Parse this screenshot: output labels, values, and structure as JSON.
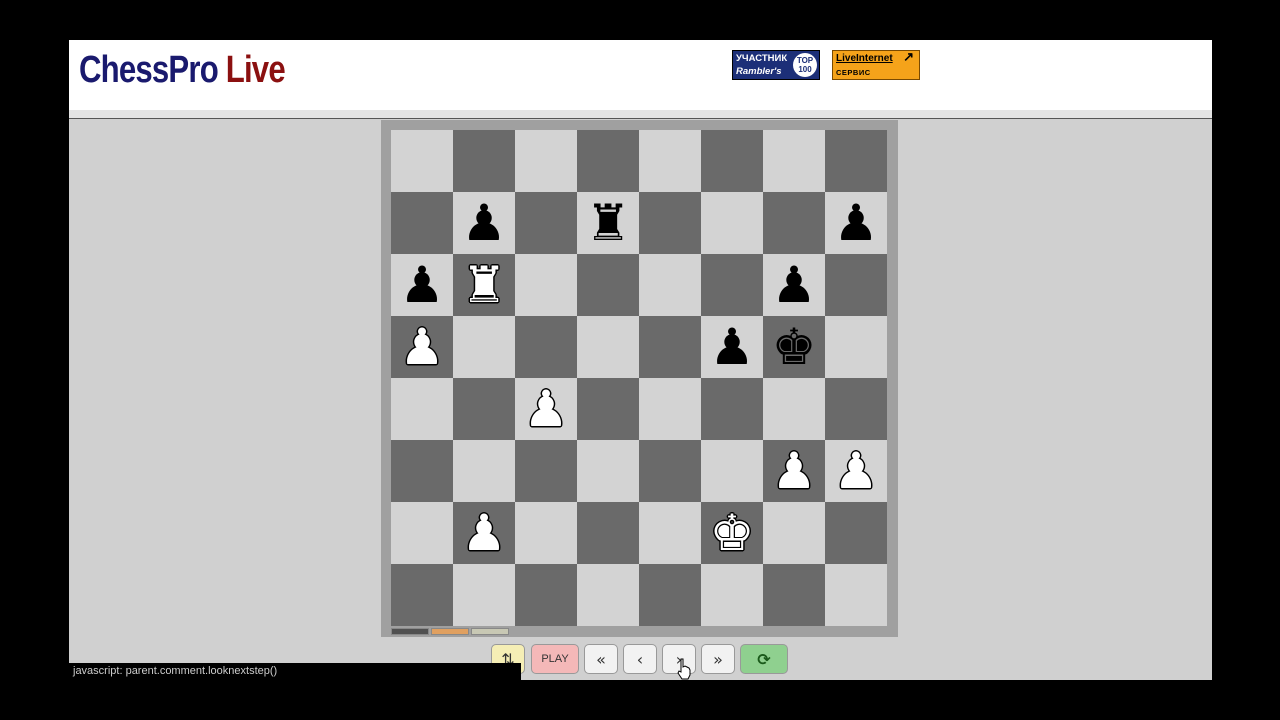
{
  "header": {
    "logo_main": "ChessPro",
    "logo_accent": "Live",
    "rambler_counter": {
      "line1": "УЧАСТНИК",
      "line2": "Rambler's",
      "badge_top": "TOP",
      "badge_num": "100"
    },
    "liveinternet_counter": {
      "line1": "LiveInternet",
      "line2": "СЕРВИС СТАТИСТИКИ"
    }
  },
  "board": {
    "light_color": "#d3d3d3",
    "dark_color": "#6a6a6a",
    "pieces": [
      {
        "square": "d7",
        "color": "black",
        "type": "rook",
        "glyph": "♜"
      },
      {
        "square": "b7",
        "color": "black",
        "type": "pawn",
        "glyph": "♟"
      },
      {
        "square": "h7",
        "color": "black",
        "type": "pawn",
        "glyph": "♟"
      },
      {
        "square": "a6",
        "color": "black",
        "type": "pawn",
        "glyph": "♟"
      },
      {
        "square": "g6",
        "color": "black",
        "type": "pawn",
        "glyph": "♟"
      },
      {
        "square": "f5",
        "color": "black",
        "type": "pawn",
        "glyph": "♟"
      },
      {
        "square": "g5",
        "color": "black",
        "type": "king",
        "glyph": "♚"
      },
      {
        "square": "b6",
        "color": "white",
        "type": "rook",
        "glyph": "♜"
      },
      {
        "square": "a5",
        "color": "white",
        "type": "pawn",
        "glyph": "♟"
      },
      {
        "square": "c4",
        "color": "white",
        "type": "pawn",
        "glyph": "♟"
      },
      {
        "square": "g3",
        "color": "white",
        "type": "pawn",
        "glyph": "♟"
      },
      {
        "square": "h3",
        "color": "white",
        "type": "pawn",
        "glyph": "♟"
      },
      {
        "square": "b2",
        "color": "white",
        "type": "pawn",
        "glyph": "♟"
      },
      {
        "square": "f2",
        "color": "white",
        "type": "king",
        "glyph": "♚"
      }
    ],
    "theme_swatches": [
      "#505050",
      "#e0a060",
      "#c8c8b4"
    ]
  },
  "controls": {
    "flip_glyph": "⇅",
    "play_label": "PLAY",
    "first_glyph": "«",
    "prev_glyph": "‹",
    "next_glyph": "›",
    "last_glyph": "»",
    "refresh_glyph": "⟳",
    "icons": [
      "flip-board-icon",
      "first-move-icon",
      "previous-move-icon",
      "next-move-icon",
      "last-move-icon",
      "refresh-icon"
    ]
  },
  "statusbar": {
    "text": "javascript: parent.comment.looknextstep()"
  }
}
